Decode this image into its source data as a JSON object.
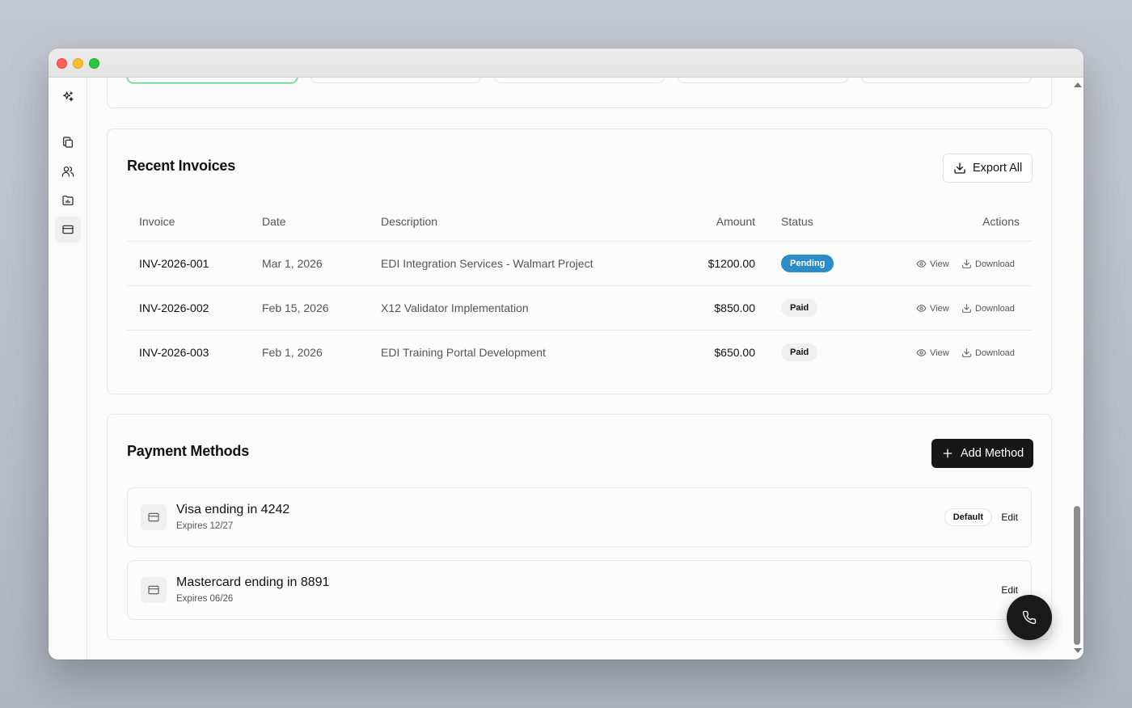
{
  "invoices": {
    "title": "Recent Invoices",
    "export_label": "Export All",
    "columns": {
      "invoice": "Invoice",
      "date": "Date",
      "description": "Description",
      "amount": "Amount",
      "status": "Status",
      "actions": "Actions"
    },
    "rows": [
      {
        "id": "INV-2026-001",
        "date": "Mar 1, 2026",
        "description": "EDI Integration Services - Walmart Project",
        "amount": "$1200.00",
        "status": "Pending"
      },
      {
        "id": "INV-2026-002",
        "date": "Feb 15, 2026",
        "description": "X12 Validator Implementation",
        "amount": "$850.00",
        "status": "Paid"
      },
      {
        "id": "INV-2026-003",
        "date": "Feb 1, 2026",
        "description": "EDI Training Portal Development",
        "amount": "$650.00",
        "status": "Paid"
      }
    ],
    "view_label": "View",
    "download_label": "Download"
  },
  "payment_methods": {
    "title": "Payment Methods",
    "add_label": "Add Method",
    "edit_label": "Edit",
    "default_label": "Default",
    "items": [
      {
        "name": "Visa ending in 4242",
        "expires": "Expires 12/27",
        "is_default": true
      },
      {
        "name": "Mastercard ending in 8891",
        "expires": "Expires 06/26",
        "is_default": false
      }
    ]
  },
  "colors": {
    "pending": "#2a8dc7",
    "accent_green": "#5ad27a",
    "dark": "#171717"
  },
  "icons": {
    "sidebar": [
      "sparkles-icon",
      "copy-icon",
      "users-icon",
      "folder-chart-icon",
      "credit-card-icon"
    ],
    "fab": "phone-icon"
  }
}
